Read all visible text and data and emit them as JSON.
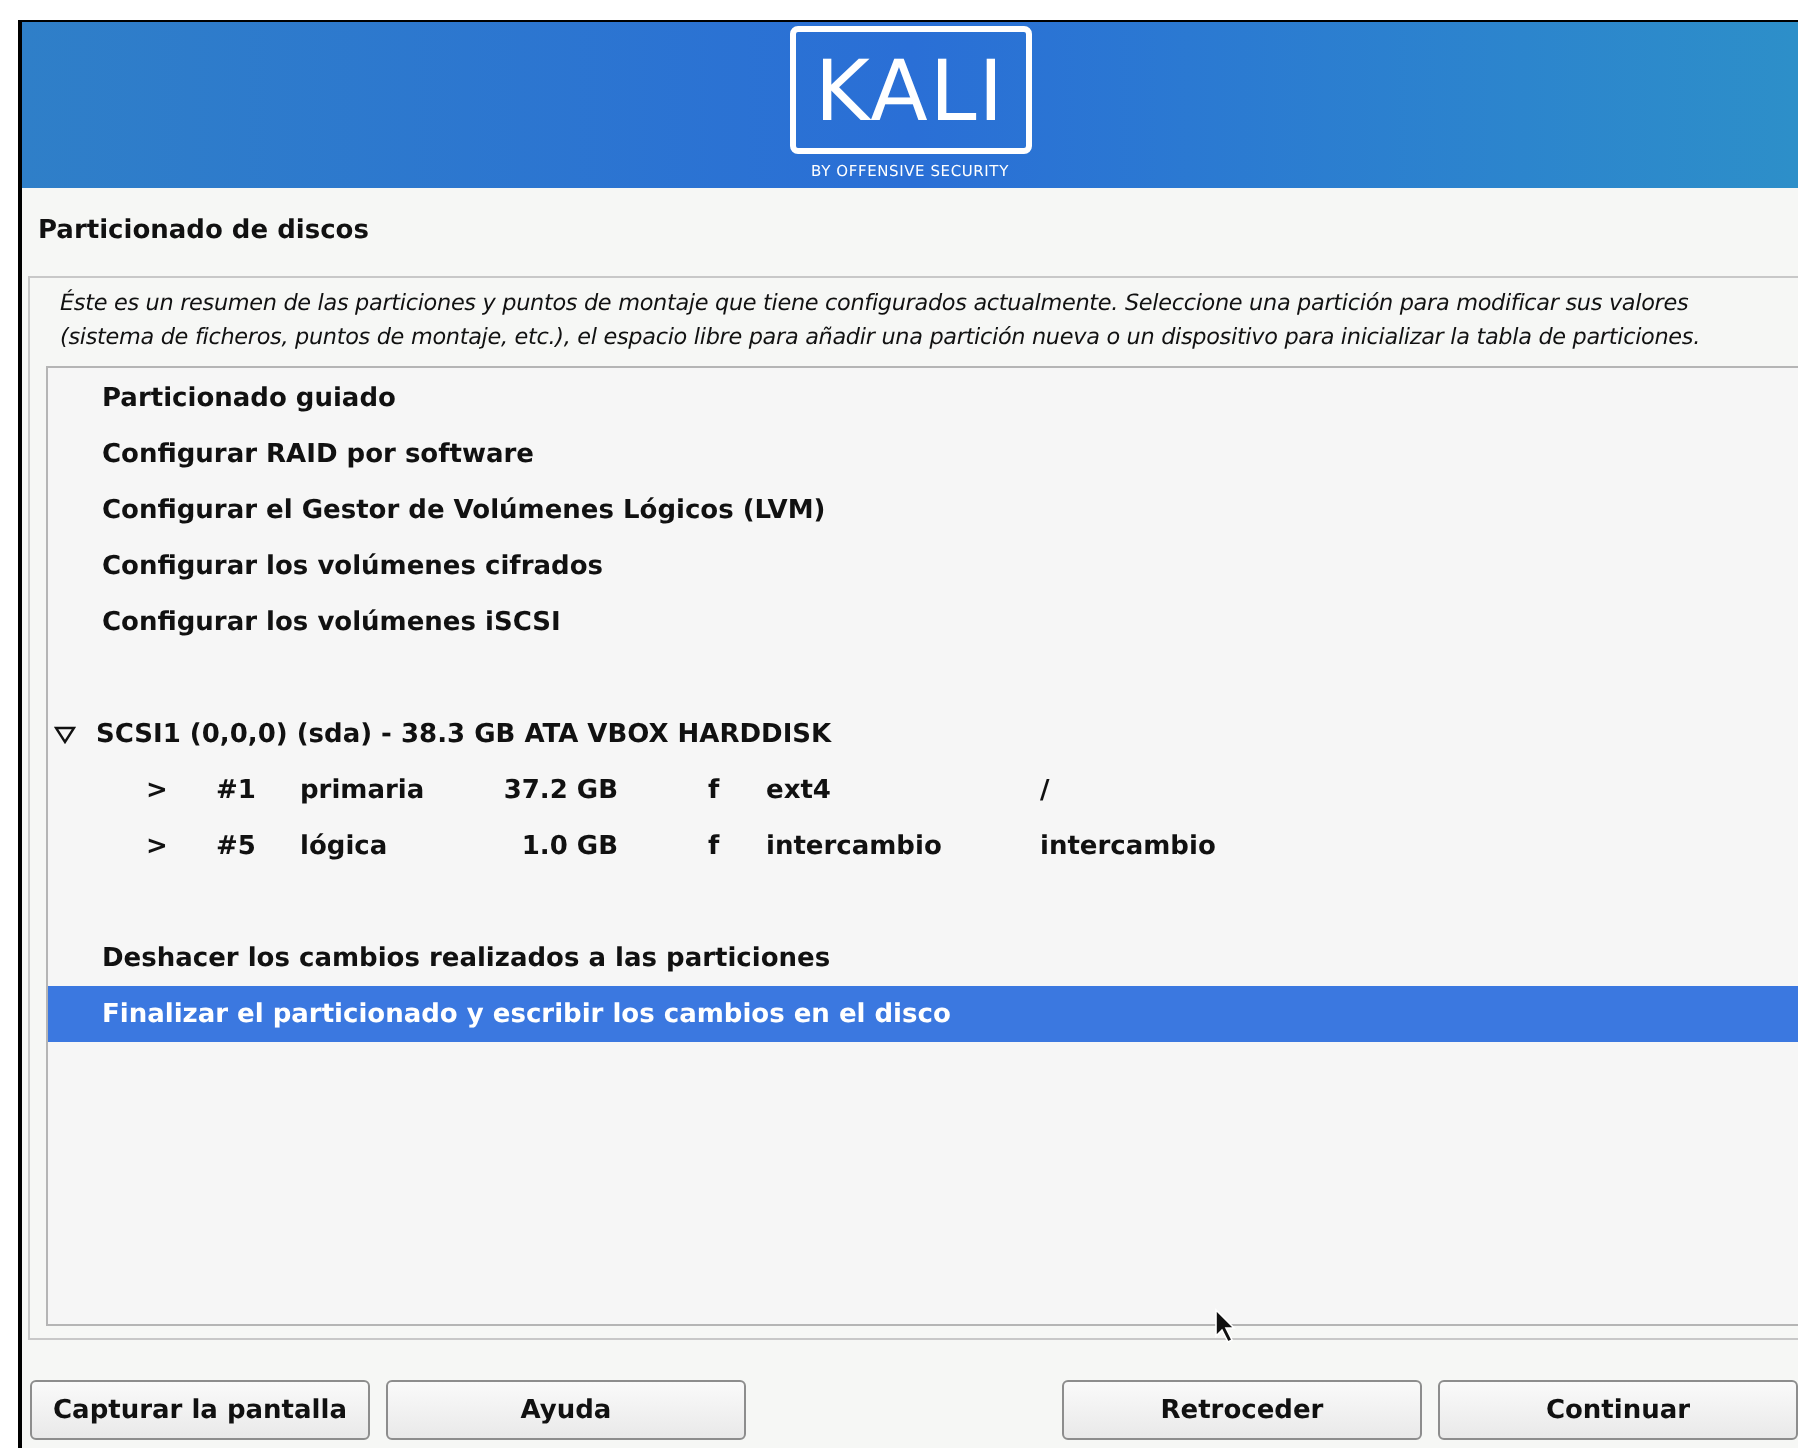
{
  "logo": {
    "name": "KALI",
    "tagline": "BY OFFENSIVE SECURITY"
  },
  "title": "Particionado de discos",
  "description": "Éste es un resumen de las particiones y puntos de montaje que tiene configurados actualmente. Seleccione una partición para modificar sus valores (sistema de ficheros, puntos de montaje, etc.), el espacio libre para añadir una partición nueva o un dispositivo para inicializar la tabla de particiones.",
  "items": [
    {
      "kind": "action",
      "label": "Particionado guiado",
      "selected": false
    },
    {
      "kind": "action",
      "label": "Configurar RAID por software",
      "selected": false
    },
    {
      "kind": "action",
      "label": "Configurar el Gestor de Volúmenes Lógicos (LVM)",
      "selected": false
    },
    {
      "kind": "action",
      "label": "Configurar los volúmenes cifrados",
      "selected": false
    },
    {
      "kind": "action",
      "label": "Configurar los volúmenes iSCSI",
      "selected": false
    },
    {
      "kind": "blank"
    },
    {
      "kind": "disk",
      "label": "SCSI1 (0,0,0) (sda) - 38.3 GB ATA VBOX HARDDISK",
      "expanded": true,
      "selected": false
    },
    {
      "kind": "partition",
      "arrow": ">",
      "number": "#1",
      "type": "primaria",
      "size": "37.2 GB",
      "flag": "f",
      "fs": "ext4",
      "mount": "/",
      "selected": false
    },
    {
      "kind": "partition",
      "arrow": ">",
      "number": "#5",
      "type": "lógica",
      "size": "1.0 GB",
      "flag": "f",
      "fs": "intercambio",
      "mount": "intercambio",
      "selected": false
    },
    {
      "kind": "blank"
    },
    {
      "kind": "action",
      "label": "Deshacer los cambios realizados a las particiones",
      "selected": false
    },
    {
      "kind": "action",
      "label": "Finalizar el particionado y escribir los cambios en el disco",
      "selected": true
    }
  ],
  "buttons_left": [
    "Capturar la pantalla",
    "Ayuda"
  ],
  "buttons_right": [
    "Retroceder",
    "Continuar"
  ]
}
